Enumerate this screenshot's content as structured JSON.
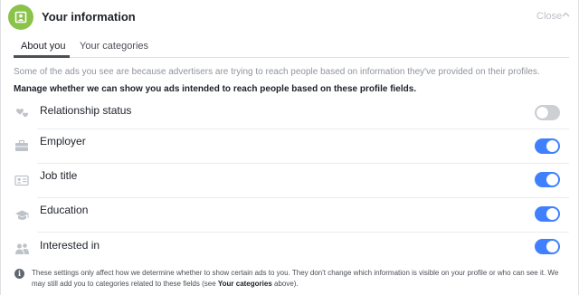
{
  "header": {
    "title": "Your information",
    "close_label": "Close",
    "icon": "profile-card-icon",
    "accent_color": "#8bc34a"
  },
  "tabs": [
    {
      "label": "About you",
      "active": true
    },
    {
      "label": "Your categories",
      "active": false
    }
  ],
  "intro_text": "Some of the ads you see are because advertisers are trying to reach people based on information they've provided on their profiles.",
  "manage_text": "Manage whether we can show you ads intended to reach people based on these profile fields.",
  "fields": [
    {
      "label": "Relationship status",
      "icon": "hearts-icon",
      "enabled": false
    },
    {
      "label": "Employer",
      "icon": "briefcase-icon",
      "enabled": true
    },
    {
      "label": "Job title",
      "icon": "id-card-icon",
      "enabled": true
    },
    {
      "label": "Education",
      "icon": "graduation-cap-icon",
      "enabled": true
    },
    {
      "label": "Interested in",
      "icon": "people-icon",
      "enabled": true
    }
  ],
  "toggle_on_color": "#4080ff",
  "toggle_off_color": "#ccd0d5",
  "footer": {
    "text_before": "These settings only affect how we determine whether to show certain ads to you. They don't change which information is visible on your profile or who can see it. We may still add you to categories related to these fields (see ",
    "link_text": "Your categories",
    "text_after": " above)."
  }
}
